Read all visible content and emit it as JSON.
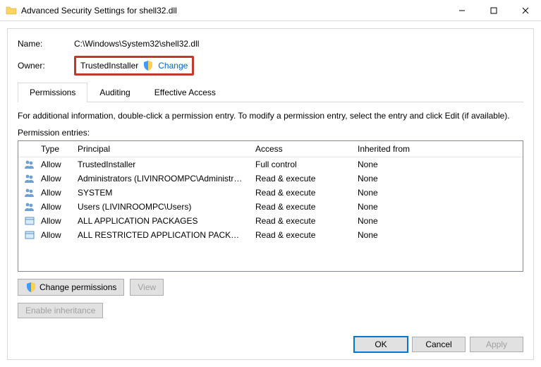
{
  "window": {
    "title": "Advanced Security Settings for shell32.dll"
  },
  "name_label": "Name:",
  "name_value": "C:\\Windows\\System32\\shell32.dll",
  "owner_label": "Owner:",
  "owner_value": "TrustedInstaller",
  "change_link": "Change",
  "tabs": {
    "permissions": "Permissions",
    "auditing": "Auditing",
    "effective": "Effective Access"
  },
  "info_text": "For additional information, double-click a permission entry. To modify a permission entry, select the entry and click Edit (if available).",
  "entries_label": "Permission entries:",
  "columns": {
    "type": "Type",
    "principal": "Principal",
    "access": "Access",
    "inherited": "Inherited from"
  },
  "entries": [
    {
      "icon": "users",
      "type": "Allow",
      "principal": "TrustedInstaller",
      "access": "Full control",
      "inherited": "None"
    },
    {
      "icon": "users",
      "type": "Allow",
      "principal": "Administrators (LIVINROOMPC\\Administra...",
      "access": "Read & execute",
      "inherited": "None"
    },
    {
      "icon": "users",
      "type": "Allow",
      "principal": "SYSTEM",
      "access": "Read & execute",
      "inherited": "None"
    },
    {
      "icon": "users",
      "type": "Allow",
      "principal": "Users (LIVINROOMPC\\Users)",
      "access": "Read & execute",
      "inherited": "None"
    },
    {
      "icon": "package",
      "type": "Allow",
      "principal": "ALL APPLICATION PACKAGES",
      "access": "Read & execute",
      "inherited": "None"
    },
    {
      "icon": "package",
      "type": "Allow",
      "principal": "ALL RESTRICTED APPLICATION PACKAGES",
      "access": "Read & execute",
      "inherited": "None"
    }
  ],
  "buttons": {
    "change_perm": "Change permissions",
    "view": "View",
    "enable_inherit": "Enable inheritance",
    "ok": "OK",
    "cancel": "Cancel",
    "apply": "Apply"
  }
}
